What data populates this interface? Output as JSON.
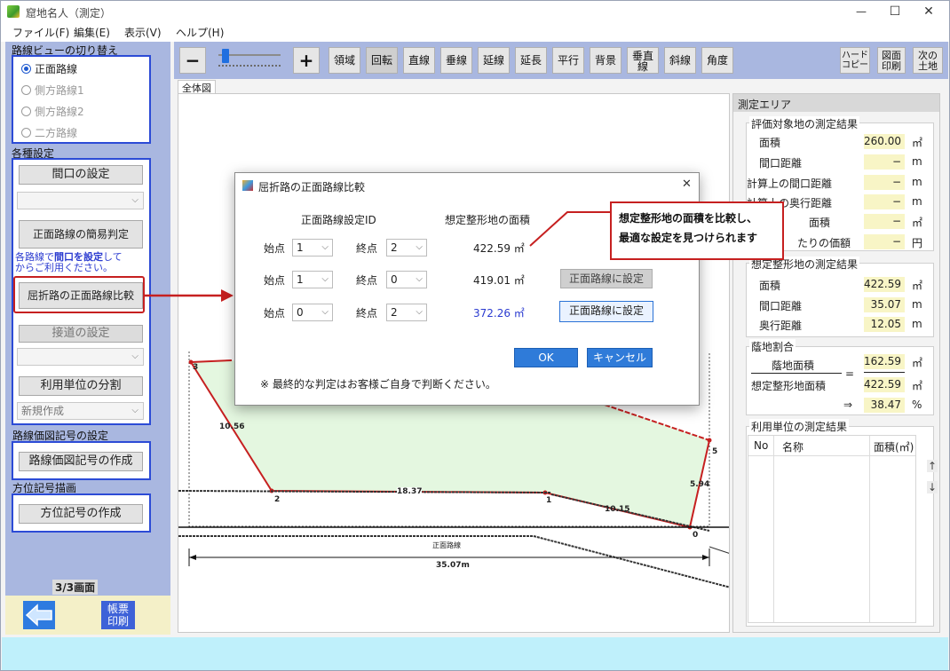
{
  "window": {
    "title": "窟地名人（測定）",
    "controls": {
      "minimize": "—",
      "maximize": "☐",
      "close": "✕"
    }
  },
  "menu": [
    "ファイル(F)",
    "編集(E)",
    "表示(V)",
    "ヘルプ(H)"
  ],
  "left": {
    "route_view_title": "路線ビューの切り替え",
    "route_options": [
      {
        "label": "正面路線",
        "selected": true
      },
      {
        "label": "側方路線1",
        "selected": false
      },
      {
        "label": "側方路線2",
        "selected": false
      },
      {
        "label": "二方路線",
        "selected": false
      }
    ],
    "settings_title": "各種設定",
    "frontage_button": "間口の設定",
    "simple_judge_button": "正面路線の簡易判定",
    "note_prefix": "各路線で",
    "note_bold": "間口を設定",
    "note_suffix": "して",
    "note_line2": "からご利用ください。",
    "compare_button": "屈折路の正面路線比較",
    "road_setting_button": "接道の設定",
    "unit_split_button": "利用単位の分割",
    "new_create": "新規作成",
    "route_symbol_title": "路線価図記号の設定",
    "route_symbol_button": "路線価図記号の作成",
    "direction_title": "方位記号描画",
    "direction_button": "方位記号の作成",
    "page_indicator": "3/3画面",
    "print_button": "帳票\n印刷"
  },
  "toolbar": {
    "minus": "−",
    "plus": "+",
    "buttons": [
      "領域",
      "回転",
      "直線",
      "垂線",
      "延線",
      "延長",
      "平行",
      "背景",
      "垂直\n線",
      "斜線",
      "角度"
    ],
    "hard_copy": "ハード\nコピー",
    "figure_print": "図面\n印刷",
    "next_land": "次の\n土地"
  },
  "canvas": {
    "tab": "全体図",
    "labels": {
      "segment_left": "10.56",
      "segment_bottom": "18.37",
      "segment_right_bottom": "10.15",
      "segment_right": "5.94",
      "vertex_0": "0",
      "vertex_1": "1",
      "vertex_2": "2",
      "vertex_3": "3",
      "vertex_5": "5",
      "road_label": "正面路線",
      "width_label": "35.07m"
    }
  },
  "measure": {
    "title": "測定エリア",
    "target_group": "評価対象地の測定結果",
    "target_rows": [
      {
        "label": "面積",
        "value": "260.00",
        "unit": "㎡"
      },
      {
        "label": "間口距離",
        "value": "−",
        "unit": "m"
      },
      {
        "label": "計算上の間口距離",
        "value": "−",
        "unit": "m"
      },
      {
        "label": "計算上の奥行距離",
        "value": "−",
        "unit": "m"
      },
      {
        "label": "面積",
        "value": "−",
        "unit": "㎡"
      },
      {
        "label": "たりの価額",
        "value": "−",
        "unit": "円"
      }
    ],
    "assumed_group": "想定整形地の測定結果",
    "assumed_rows": [
      {
        "label": "面積",
        "value": "422.59",
        "unit": "㎡"
      },
      {
        "label": "間口距離",
        "value": "35.07",
        "unit": "m"
      },
      {
        "label": "奥行距離",
        "value": "12.05",
        "unit": "m"
      }
    ],
    "ratio_group": "蔭地割合",
    "ratio_numerator_label": "蔭地面積",
    "ratio_numerator_value": "162.59",
    "ratio_denominator_label": "想定整形地面積",
    "ratio_denominator_value": "422.59",
    "ratio_equals": "=",
    "ratio_arrow": "⇒",
    "ratio_result": "38.47",
    "ratio_unit_area": "㎡",
    "ratio_unit_pct": "%",
    "usage_group": "利用単位の測定結果",
    "usage_cols": [
      "No",
      "名称",
      "面積(㎡)"
    ],
    "scroll_up": "↑",
    "scroll_down": "↓"
  },
  "dialog": {
    "title": "屈折路の正面路線比較",
    "close": "✕",
    "col_id": "正面路線設定ID",
    "col_area": "想定整形地の面積",
    "rows": [
      {
        "start_label": "始点",
        "start": "1",
        "end_label": "終点",
        "end": "2",
        "area": "422.59 ㎡",
        "has_button": false
      },
      {
        "start_label": "始点",
        "start": "1",
        "end_label": "終点",
        "end": "0",
        "area": "419.01 ㎡",
        "has_button": true,
        "button": "正面路線に設定",
        "button_disabled": true
      },
      {
        "start_label": "始点",
        "start": "0",
        "end_label": "終点",
        "end": "2",
        "area": "372.26 ㎡",
        "has_button": true,
        "button": "正面路線に設定",
        "button_disabled": false,
        "highlight": true
      }
    ],
    "ok": "OK",
    "cancel": "キャンセル",
    "note": "※ 最終的な判定はお客様ご自身で判断ください。"
  },
  "callout": {
    "line1": "想定整形地の面積を比較し、",
    "line2": "最適な設定を見つけられます"
  },
  "colors": {
    "panel_blue": "#a9b7e0",
    "section_border": "#2c4bd6",
    "highlight_red": "#c62020",
    "value_yellow": "#f8f5c6",
    "link_blue": "#2b3bd0",
    "status_cyan": "#bff0fb",
    "land_green": "#e4f7e0"
  }
}
